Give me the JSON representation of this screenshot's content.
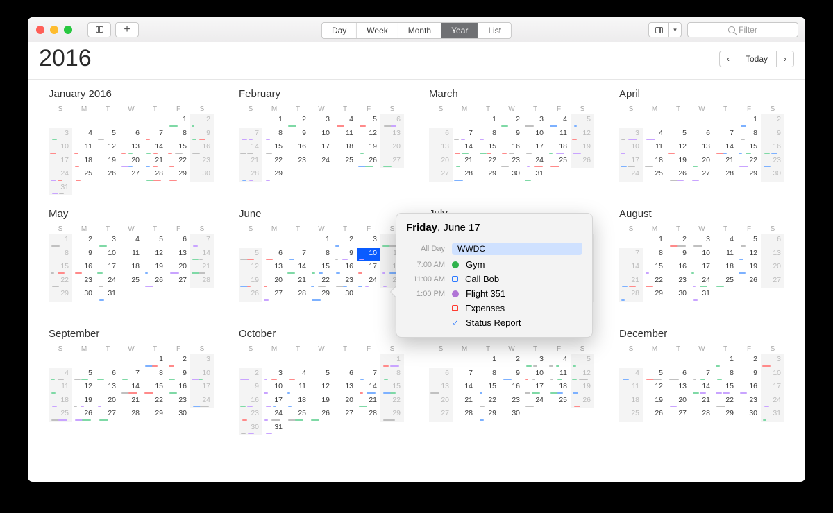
{
  "toolbar": {
    "views": [
      "Day",
      "Week",
      "Month",
      "Year",
      "List"
    ],
    "active": "Year",
    "search_placeholder": "Filter"
  },
  "header": {
    "year": "2016",
    "today": "Today"
  },
  "dow": [
    "S",
    "M",
    "T",
    "W",
    "T",
    "F",
    "S"
  ],
  "months": [
    {
      "name": "January 2016",
      "start": 5,
      "days": 31
    },
    {
      "name": "February",
      "start": 1,
      "days": 29
    },
    {
      "name": "March",
      "start": 2,
      "days": 31
    },
    {
      "name": "April",
      "start": 5,
      "days": 30
    },
    {
      "name": "May",
      "start": 0,
      "days": 31
    },
    {
      "name": "June",
      "start": 3,
      "days": 30,
      "sel": 10
    },
    {
      "name": "July",
      "start": 5,
      "days": 31
    },
    {
      "name": "August",
      "start": 1,
      "days": 31
    },
    {
      "name": "September",
      "start": 4,
      "days": 30
    },
    {
      "name": "October",
      "start": 6,
      "days": 31
    },
    {
      "name": "November",
      "start": 2,
      "days": 30
    },
    {
      "name": "December",
      "start": 4,
      "days": 31
    }
  ],
  "popover": {
    "weekday": "Friday",
    "rest": ", June 17",
    "events": [
      {
        "time": "All Day",
        "label": "WWDC",
        "type": "allday",
        "color": "#cfe1ff"
      },
      {
        "time": "7:00 AM",
        "label": "Gym",
        "type": "dot",
        "color": "#2fb24c"
      },
      {
        "time": "11:00 AM",
        "label": "Call Bob",
        "type": "box",
        "color": "#2f7bff"
      },
      {
        "time": "1:00 PM",
        "label": "Flight 351",
        "type": "dot",
        "color": "#b074d6"
      },
      {
        "time": "",
        "label": "Expenses",
        "type": "box",
        "color": "#ff3b30"
      },
      {
        "time": "",
        "label": "Status Report",
        "type": "check"
      }
    ]
  },
  "marker_colors": [
    "blue",
    "red",
    "green",
    "purple",
    "gray"
  ]
}
